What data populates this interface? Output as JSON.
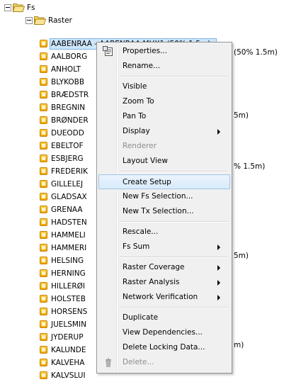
{
  "tree": {
    "root_label": "Fs",
    "raster_label": "Raster",
    "selected_item": "AABENRAA - AABENRAA MUX1 (50% 1.5m)",
    "items": [
      "AALBORG",
      "ANHOLT",
      "BLYKOBB",
      "BRÆDSTR",
      "BREGNIN",
      "BRØNDER",
      "DUEODD",
      "EBELTOF",
      "ESBJERG",
      "FREDERIK",
      "GILLELEJ",
      "GLADSAX",
      "GRENAA",
      "HADSTEN",
      "HAMMELI",
      "HAMMERI",
      "HELSING",
      "HERNING",
      "HILLERØI",
      "HOLSTEB",
      "HORSENS",
      "JUELSMIN",
      "JYDERUP",
      "KALUNDE",
      "KALVEHA",
      "KALVSLUI"
    ],
    "visible_suffixes": {
      "aalborg": "(50% 1.5m)",
      "brønder": "5m)",
      "frederik": "% 1.5m)",
      "helsing": "5m)",
      "kalunde": "m)"
    }
  },
  "context_menu": {
    "items": [
      {
        "label": "Properties...",
        "icon": "properties-icon",
        "submenu": false,
        "disabled": false
      },
      {
        "label": "Rename...",
        "submenu": false,
        "disabled": false
      },
      {
        "separator": true
      },
      {
        "label": "Visible",
        "submenu": false,
        "disabled": false
      },
      {
        "label": "Zoom To",
        "submenu": false,
        "disabled": false
      },
      {
        "label": "Pan To",
        "submenu": false,
        "disabled": false
      },
      {
        "label": "Display",
        "submenu": true,
        "disabled": false
      },
      {
        "label": "Renderer",
        "submenu": false,
        "disabled": true
      },
      {
        "label": "Layout View",
        "submenu": false,
        "disabled": false
      },
      {
        "separator": true
      },
      {
        "label": "Create Setup",
        "submenu": false,
        "disabled": false,
        "highlighted": true
      },
      {
        "label": "New Fs Selection...",
        "submenu": false,
        "disabled": false
      },
      {
        "label": "New Tx Selection...",
        "submenu": false,
        "disabled": false
      },
      {
        "separator": true
      },
      {
        "label": "Rescale...",
        "submenu": false,
        "disabled": false
      },
      {
        "label": "Fs Sum",
        "submenu": true,
        "disabled": false
      },
      {
        "separator": true
      },
      {
        "label": "Raster Coverage",
        "submenu": true,
        "disabled": false
      },
      {
        "label": "Raster Analysis",
        "submenu": true,
        "disabled": false
      },
      {
        "label": "Network Verification",
        "submenu": true,
        "disabled": false
      },
      {
        "separator": true
      },
      {
        "label": "Duplicate",
        "submenu": false,
        "disabled": false
      },
      {
        "label": "View Dependencies...",
        "submenu": false,
        "disabled": false
      },
      {
        "label": "Delete Locking Data...",
        "submenu": false,
        "disabled": false
      },
      {
        "label": "Delete...",
        "icon": "trash-icon",
        "submenu": false,
        "disabled": true
      }
    ]
  },
  "colors": {
    "selection_bg": "#cde6fb",
    "menu_bg": "#f0f0f0",
    "highlight_border": "#9fc4ea",
    "disabled_text": "#8d8d8d"
  }
}
